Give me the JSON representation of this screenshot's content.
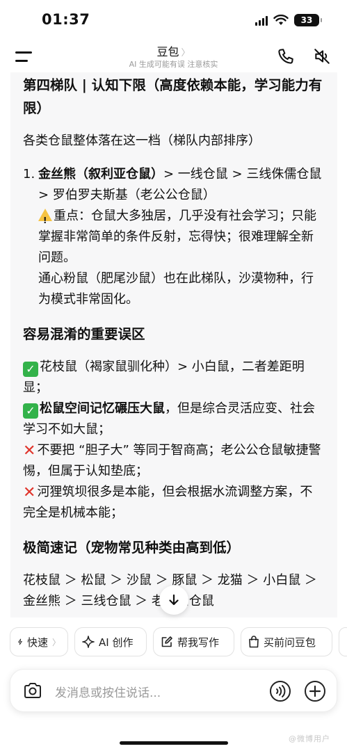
{
  "status_bar": {
    "time": "01:37",
    "battery": "33"
  },
  "header": {
    "title": "豆包",
    "title_chevron": "〉",
    "subtitle": "AI 生成可能有误 注意核实"
  },
  "content": {
    "h_tier4": "第四梯队 | 认知下限（高度依赖本能，学习能力有限）",
    "tier4_intro": "各类仓鼠整体落在这一档（梯队内部排序）",
    "item1_num": "1.",
    "item1_bold": "金丝熊（叙利亚仓鼠）",
    "item1_rest": "> 一线仓鼠 > 三线侏儒仓鼠 > 罗伯罗夫斯基（老公公仓鼠）",
    "item1_warn_text": "重点：仓鼠大多独居，几乎没有社会学习；只能掌握非常简单的条件反射，忘得快；很难理解全新问题。",
    "item1_extra": "通心粉鼠（肥尾沙鼠）也在此梯队，沙漠物种，行为模式非常固化。",
    "h_mistakes": "容易混淆的重要误区",
    "m1_text": "花枝鼠（褐家鼠驯化种）> 小白鼠，二者差距明显；",
    "m2_bold": "松鼠空间记忆碾压大鼠",
    "m2_rest": "，但是综合灵活应变、社会学习不如大鼠；",
    "m3_text": "不要把 “胆子大” 等同于智商高；老公公仓鼠敏捷警惕，但属于认知垫底；",
    "m4_text": "河狸筑坝很多是本能，但会根据水流调整方案，不完全是机械本能；",
    "h_summary": "极简速记（宠物常见种类由高到低）",
    "summary_text": "花枝鼠 ＞ 松鼠 ＞ 沙鼠 ＞ 豚鼠 ＞ 龙猫 ＞ 小白鼠 ＞ 金丝熊 ＞ 三线仓鼠 ＞ 老公公仓鼠"
  },
  "chips": [
    {
      "label": "快速",
      "icon": "lightning-icon"
    },
    {
      "label": "AI 创作",
      "icon": "sparkle-icon"
    },
    {
      "label": "帮我写作",
      "icon": "edit-icon"
    },
    {
      "label": "买前问豆包",
      "icon": "shopping-bag-icon"
    }
  ],
  "input": {
    "placeholder": "发消息或按住说话..."
  },
  "watermark": "@微博用户",
  "colors": {
    "check_green": "#33b24a",
    "cross_red": "#e0342b",
    "warn_yellow": "#f6c343"
  }
}
